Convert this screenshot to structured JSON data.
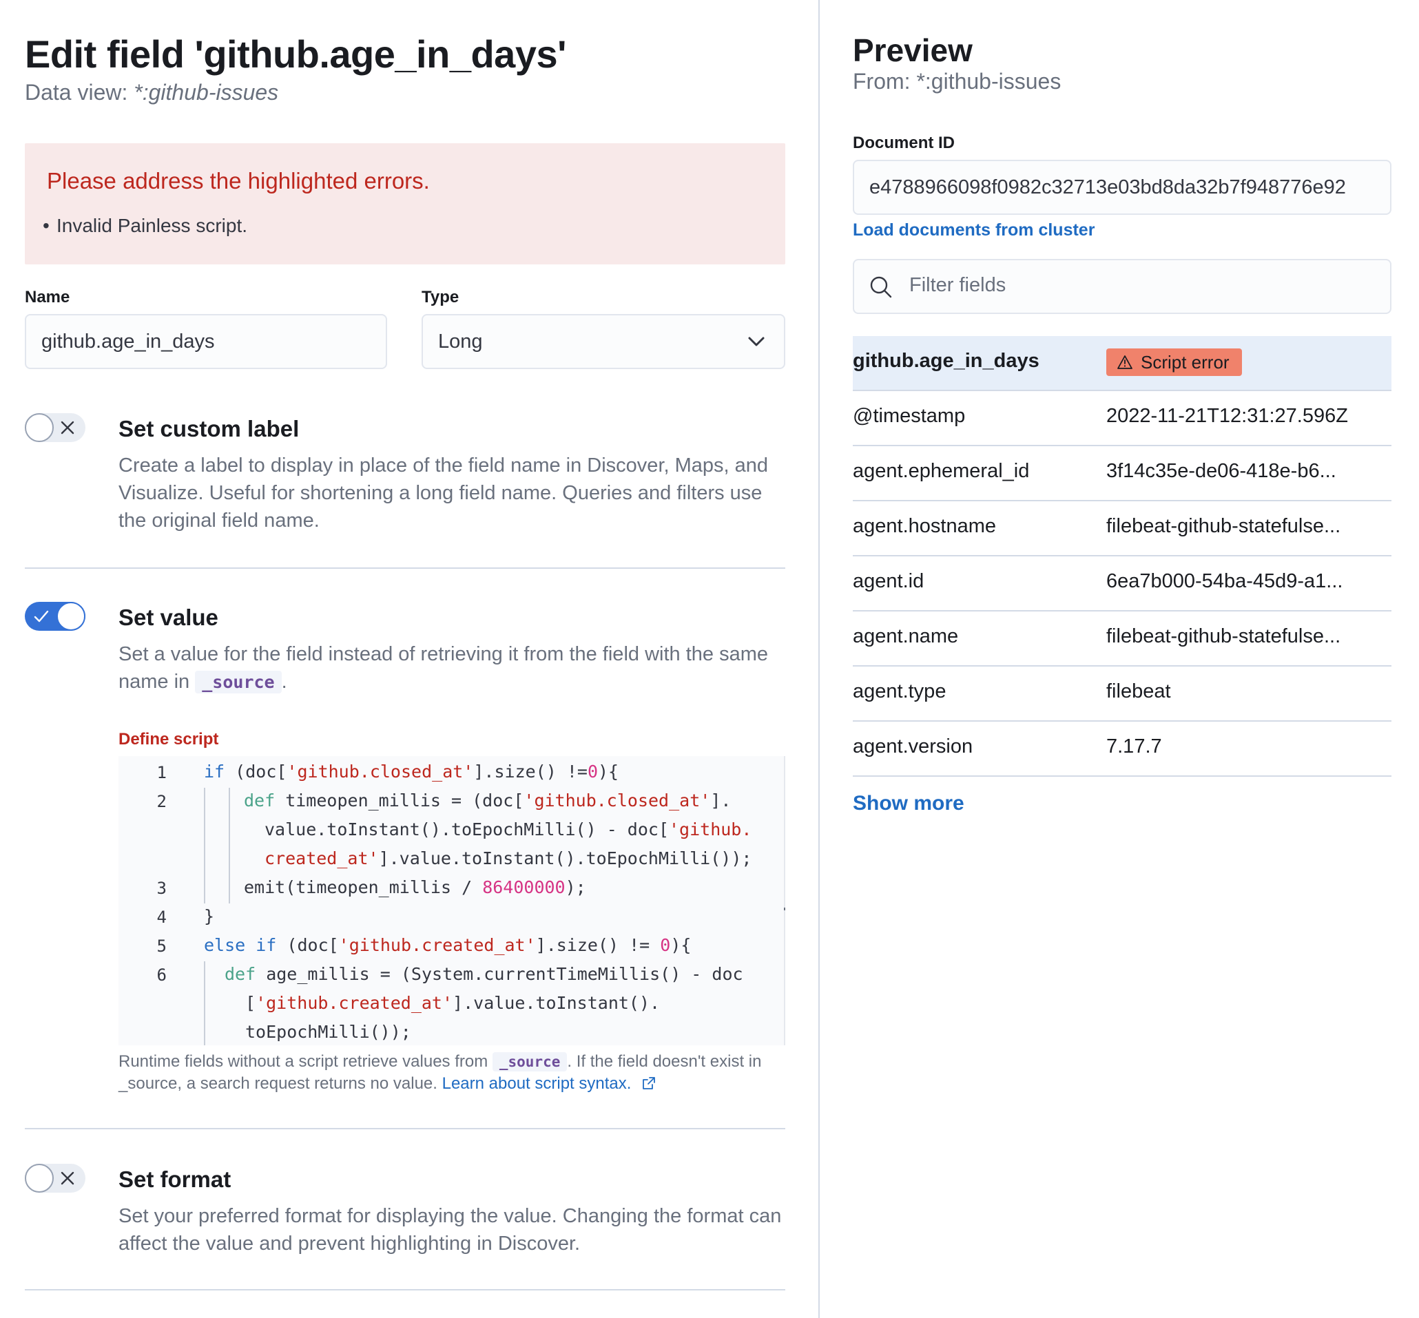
{
  "left": {
    "title": "Edit field 'github.age_in_days'",
    "data_view_label": "Data view: ",
    "data_view_value": "*:github-issues",
    "callout": {
      "title": "Please address the highlighted errors.",
      "items": [
        "Invalid Painless script."
      ]
    },
    "name_label": "Name",
    "name_value": "github.age_in_days",
    "type_label": "Type",
    "type_value": "Long",
    "custom_label": {
      "title": "Set custom label",
      "description": "Create a label to display in place of the field name in Discover, Maps, and Visualize. Useful for shortening a long field name. Queries and filters use the original field name.",
      "enabled": false
    },
    "set_value": {
      "title": "Set value",
      "desc_before": "Set a value for the field instead of retrieving it from the field with the same name in ",
      "desc_code": "_source",
      "desc_after": ".",
      "enabled": true
    },
    "script": {
      "label": "Define script",
      "line_numbers": [
        "1",
        "2",
        "3",
        "4",
        "5",
        "6"
      ],
      "help_before": "Runtime fields without a script retrieve values from ",
      "help_code": "_source",
      "help_after": ". If the field doesn't exist in _source, a search request returns no value. ",
      "help_link": "Learn about script syntax."
    },
    "format": {
      "title": "Set format",
      "description": "Set your preferred format for displaying the value. Changing the format can affect the value and prevent highlighting in Discover.",
      "enabled": false
    }
  },
  "preview": {
    "title": "Preview",
    "from": "From: *:github-issues",
    "document_id_label": "Document ID",
    "document_id_value": "e4788966098f0982c32713e03bd8da32b7f948776e92",
    "load_link": "Load documents from cluster",
    "filter_placeholder": "Filter fields",
    "rows": [
      {
        "key": "github.age_in_days",
        "value": "Script error",
        "badge": true
      },
      {
        "key": "@timestamp",
        "value": "2022-11-21T12:31:27.596Z"
      },
      {
        "key": "agent.ephemeral_id",
        "value": "3f14c35e-de06-418e-b6..."
      },
      {
        "key": "agent.hostname",
        "value": "filebeat-github-statefulse..."
      },
      {
        "key": "agent.id",
        "value": "6ea7b000-54ba-45d9-a1..."
      },
      {
        "key": "agent.name",
        "value": "filebeat-github-statefulse..."
      },
      {
        "key": "agent.type",
        "value": "filebeat"
      },
      {
        "key": "agent.version",
        "value": "7.17.7"
      }
    ],
    "show_more": "Show more"
  },
  "colors": {
    "error": "#bd271e",
    "primary": "#3471d6",
    "link": "#1f6bc2",
    "badge_danger": "#f0826b",
    "callout_bg": "#f8e9e9"
  }
}
